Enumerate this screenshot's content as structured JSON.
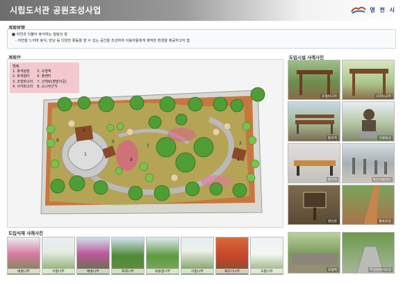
{
  "header": {
    "title": "시립도서관 공원조성사업",
    "logo_text": "영 천 시",
    "logo_icon": "cloud-logo-icon"
  },
  "direction": {
    "heading": "계획방향",
    "line1": "■ 자연과 더불어 휴식하는 힐링의 장",
    "line2": "- 자연을 느끼며 휴식, 만남 등 다양한 활동을 할 수 있는 공간을 조성하여 이용자들에게 쾌적한 환경을 제공하고자 함"
  },
  "plan": {
    "heading": "계획안",
    "legend_title": "범례",
    "legend_left": [
      "1. 휴게광장",
      "2. 휴게쉼터",
      "3. 조형파고라",
      "4. 사각파고라"
    ],
    "legend_right": [
      "5. 조형벽",
      "6. 플랜터",
      "7. 산책로(맨발의길)",
      "8. 소나무군식"
    ],
    "markers": [
      "1",
      "2",
      "3",
      "4",
      "5",
      "6",
      "7",
      "8"
    ]
  },
  "facility": {
    "heading": "도입시설 사례사진",
    "photos": [
      "조형파고라",
      "사각파고라",
      "등의자",
      "인물동상",
      "평의자",
      "화강석볼라드",
      "명언판",
      "황토포장",
      "조형벽",
      "부정형판석포장"
    ]
  },
  "planting": {
    "heading": "도입식재 사례사진",
    "photos": [
      "배롱나무",
      "이팝나무",
      "배롱나무",
      "회화나무",
      "대왕참나무",
      "이팝나무",
      "복자기나무",
      "조팝나무"
    ]
  },
  "colors": {
    "header_dark": "#6d6d6d",
    "legend_bg": "#f3c9cf",
    "deck": "#c7773e",
    "path": "#b9b9b9",
    "green": "#5aa83a"
  }
}
